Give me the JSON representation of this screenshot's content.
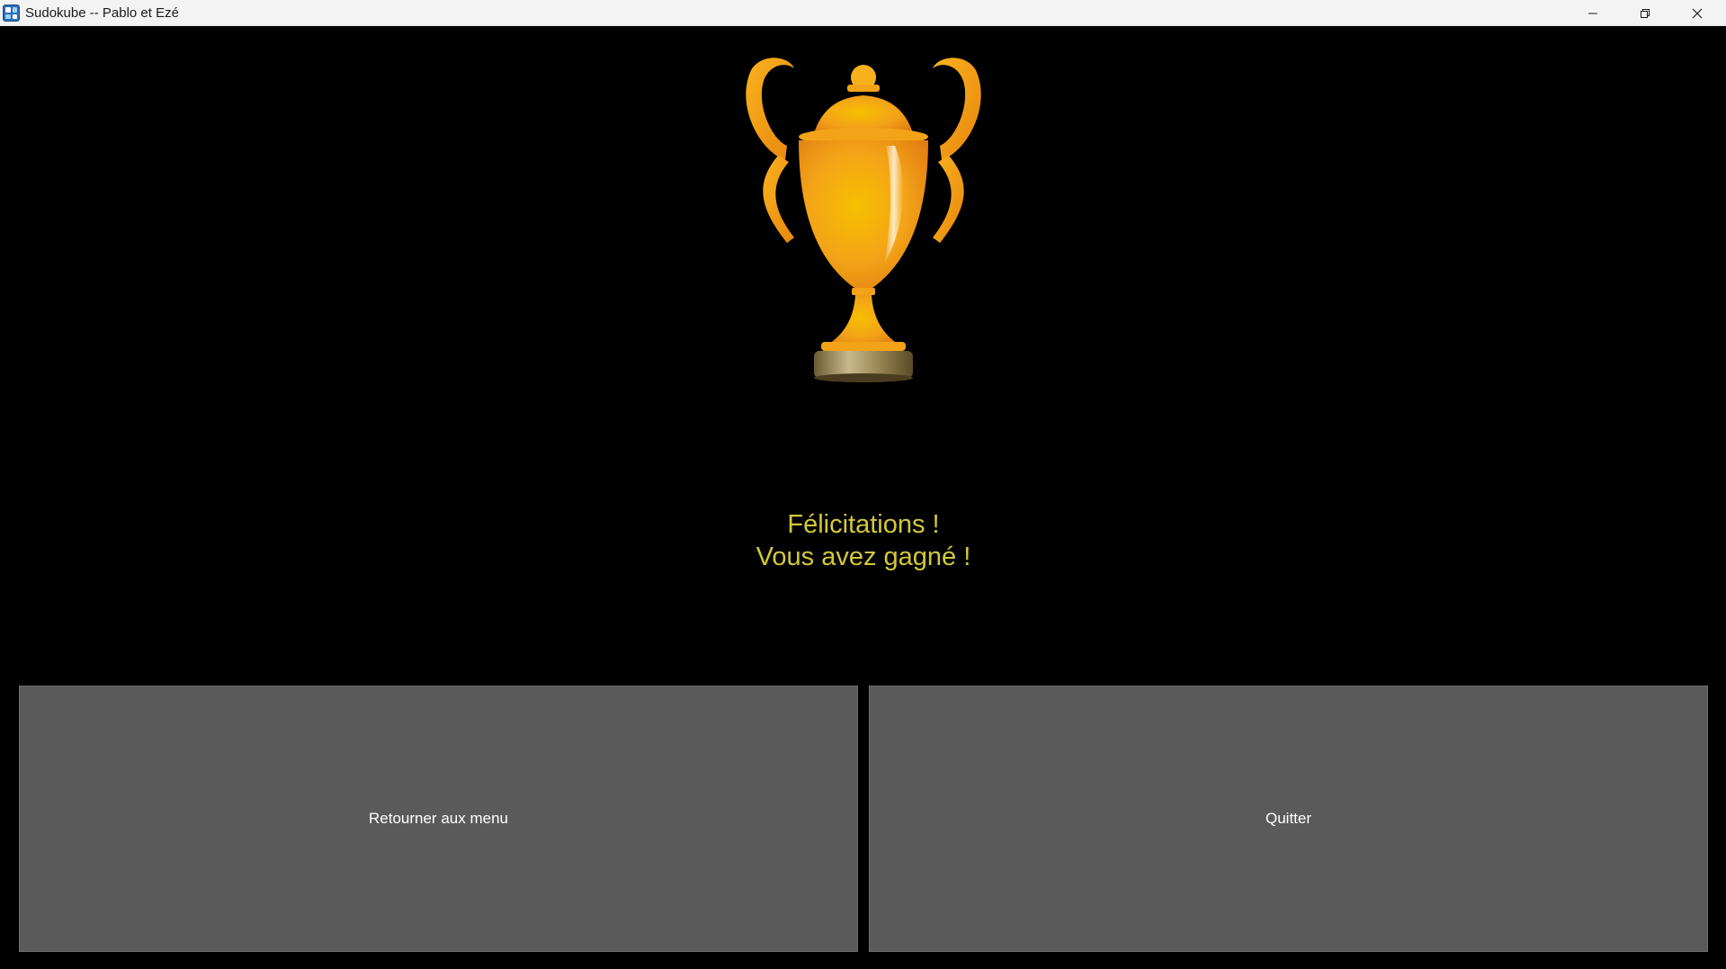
{
  "window": {
    "title": "Sudokube -- Pablo et Ezé",
    "app_icon": "sudokube-app-icon",
    "controls": {
      "minimize_icon": "minimize-icon",
      "maximize_icon": "restore-icon",
      "close_icon": "close-icon"
    }
  },
  "victory": {
    "image": "trophy-icon",
    "line1": "Félicitations !",
    "line2": "Vous avez gagné !",
    "text_color": "#d4c83a"
  },
  "buttons": {
    "menu_label": "Retourner aux menu",
    "quit_label": "Quitter",
    "background": "#5a5a5a"
  },
  "colors": {
    "background": "#000000",
    "titlebar": "#f3f3f3",
    "trophy_gold": "#f2a81d"
  }
}
